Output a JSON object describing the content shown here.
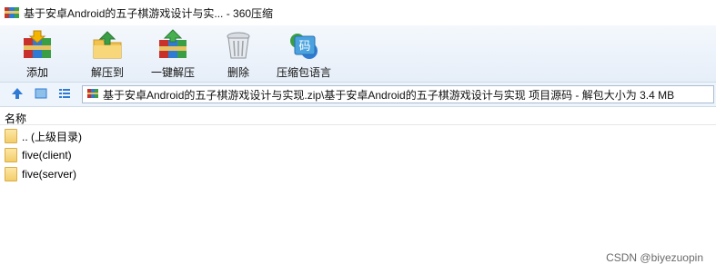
{
  "window": {
    "title": "基于安卓Android的五子棋游戏设计与实... - 360压缩"
  },
  "toolbar": {
    "items": [
      {
        "label": "添加",
        "icon": "add-archive-icon"
      },
      {
        "label": "解压到",
        "icon": "extract-to-icon"
      },
      {
        "label": "一键解压",
        "icon": "one-click-extract-icon"
      },
      {
        "label": "删除",
        "icon": "delete-icon"
      },
      {
        "label": "压缩包语言",
        "icon": "archive-language-icon"
      }
    ],
    "language_glyph": "码"
  },
  "nav": {
    "path": "基于安卓Android的五子棋游戏设计与实现.zip\\基于安卓Android的五子棋游戏设计与实现 项目源码 - 解包大小为 3.4 MB"
  },
  "list": {
    "column_name": "名称",
    "items": [
      {
        "name": ".. (上级目录)"
      },
      {
        "name": "five(client)"
      },
      {
        "name": "five(server)"
      }
    ]
  },
  "watermark": "CSDN @biyezuopin"
}
